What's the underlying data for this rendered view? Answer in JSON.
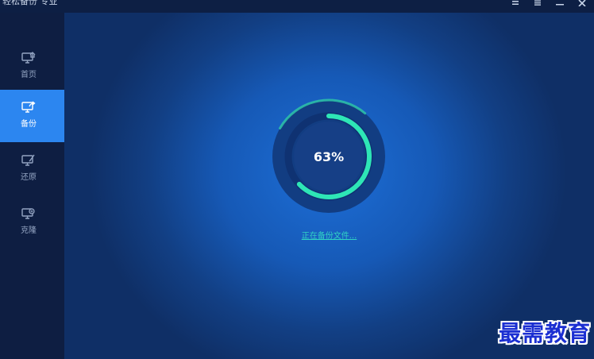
{
  "window": {
    "title": "轻松备份 专业",
    "controls": [
      "menu-icon",
      "list-icon",
      "minimize-icon",
      "close-icon"
    ]
  },
  "sidebar": {
    "items": [
      {
        "label": "首页",
        "icon": "home-monitor-icon",
        "active": false
      },
      {
        "label": "备份",
        "icon": "backup-monitor-icon",
        "active": true
      },
      {
        "label": "还原",
        "icon": "restore-monitor-icon",
        "active": false
      },
      {
        "label": "克隆",
        "icon": "clone-monitor-icon",
        "active": false
      }
    ]
  },
  "progress": {
    "value": 0.63,
    "label": "63%",
    "status_text": "正在备份文件..."
  },
  "watermark": {
    "text": "最需教育"
  },
  "colors": {
    "accent": "#2c86f0",
    "progress": "#2ee6b6",
    "sidebar_bg": "#0e1e42",
    "main_bg": "#1659b6"
  }
}
